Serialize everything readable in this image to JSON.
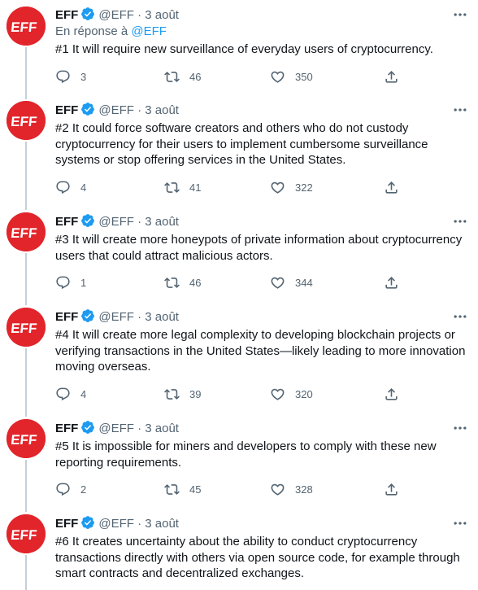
{
  "tweets": [
    {
      "name": "EFF",
      "handle": "@EFF",
      "sep": "·",
      "date": "3 août",
      "reply_prefix": "En réponse à",
      "reply_handle": "@EFF",
      "text": "#1 It will require new surveillance of everyday users of cryptocurrency.",
      "replies": "3",
      "retweets": "46",
      "likes": "350"
    },
    {
      "name": "EFF",
      "handle": "@EFF",
      "sep": "·",
      "date": "3 août",
      "text": "#2 It could force software creators and others who do not custody cryptocurrency for their users to implement cumbersome surveillance systems or stop offering services in the United States.",
      "replies": "4",
      "retweets": "41",
      "likes": "322"
    },
    {
      "name": "EFF",
      "handle": "@EFF",
      "sep": "·",
      "date": "3 août",
      "text": "#3 It will create more honeypots of private information about cryptocurrency users that could attract malicious actors.",
      "replies": "1",
      "retweets": "46",
      "likes": "344"
    },
    {
      "name": "EFF",
      "handle": "@EFF",
      "sep": "·",
      "date": "3 août",
      "text": "#4 It will create more legal complexity to developing blockchain projects or verifying transactions in the United States—likely leading to more innovation moving overseas.",
      "replies": "4",
      "retweets": "39",
      "likes": "320"
    },
    {
      "name": "EFF",
      "handle": "@EFF",
      "sep": "·",
      "date": "3 août",
      "text": "#5 It is impossible for miners and developers to comply with these new reporting requirements.",
      "replies": "2",
      "retweets": "45",
      "likes": "328"
    },
    {
      "name": "EFF",
      "handle": "@EFF",
      "sep": "·",
      "date": "3 août",
      "text": "#6 It creates uncertainty about the ability to conduct cryptocurrency transactions directly with others via open source code, for example through smart contracts and decentralized exchanges."
    }
  ],
  "avatar": {
    "logo_text": "EFF",
    "color": "#e1252b"
  },
  "colors": {
    "verified": "#1d9bf0",
    "link": "#1d9bf0",
    "muted": "#536471",
    "thread": "#c4cfd6"
  }
}
